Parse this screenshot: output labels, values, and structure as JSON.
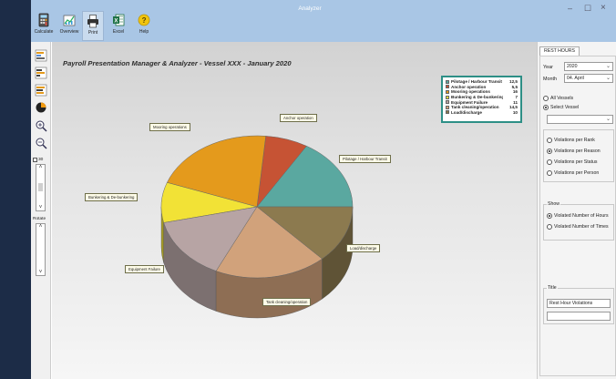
{
  "app": {
    "title": "Analyzer",
    "min": "–",
    "max": "☐",
    "close": "×"
  },
  "toolbar": {
    "calculate": "Calculate",
    "overview": "Overview",
    "print": "Print",
    "excel": "Excel",
    "help": "Help"
  },
  "sidetools": {
    "zoom_value": "30",
    "rotate": "Rotate"
  },
  "chart": {
    "title": "Payroll Presentation Manager & Analyzer - Vessel XXX - January 2020"
  },
  "chart_data": {
    "type": "pie",
    "title": "Payroll Presentation Manager & Analyzer - Vessel XXX - January 2020",
    "slices": [
      {
        "name": "Pilotage / Harbour Transit",
        "value": 12.5,
        "color": "#5aa8a0"
      },
      {
        "name": "Anchor operation",
        "value": 5.5,
        "color": "#c65334"
      },
      {
        "name": "Mooring operations",
        "value": 16,
        "color": "#e49a1c"
      },
      {
        "name": "Bunkering & De-bunkering",
        "value": 7,
        "color": "#f2e236"
      },
      {
        "name": "Equipment Failure",
        "value": 11,
        "color": "#b7a4a4"
      },
      {
        "name": "Tank cleaning/operation",
        "value": 14.5,
        "color": "#d1a27b"
      },
      {
        "name": "Load/discharge",
        "value": 10,
        "color": "#8c7a4f"
      }
    ],
    "callouts": {
      "anchor": "Anchor operation",
      "mooring": "Mooring operations",
      "pilotage": "Pilotage / Harbour Transit",
      "bunkering": "Bunkering & De-bunkering",
      "load": "Load/discharge",
      "equipment": "Equipment Failure",
      "tank": "Tank cleaning/operation"
    },
    "legend_placement": "top-right"
  },
  "right_panel": {
    "tab": "REST HOURS",
    "year_label": "Year",
    "year_value": "2020",
    "month_label": "Month",
    "month_value": "04. April",
    "all_vessels": "All Vessels",
    "select_vessel": "Select Vessel",
    "vessel_value": "",
    "violations_rank": "Violations per Rank",
    "violations_reason": "Violations per Reason",
    "violations_status": "Violations per Status",
    "violations_person": "Violations per Person",
    "show_label": "Show",
    "violated_hours": "Violated Number of Hours",
    "violated_times": "Violated Number of Times",
    "title_label": "Title",
    "title_value": "Rest Hour Violations",
    "title_value2": ""
  }
}
